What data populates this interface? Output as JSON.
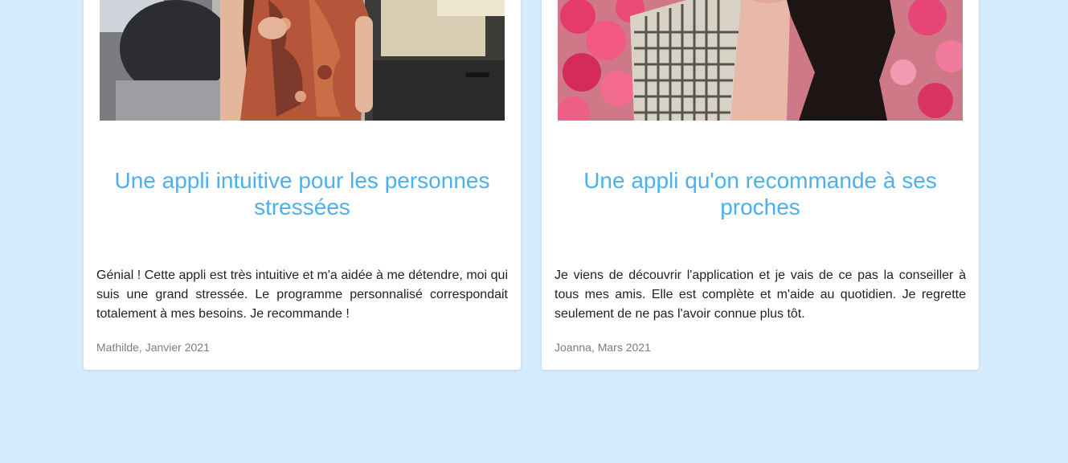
{
  "colors": {
    "page_background": "#d6ecfd",
    "card_background": "#ffffff",
    "title": "#4db0ec",
    "body_text": "#222222",
    "author_text": "#7d7d7d"
  },
  "testimonials": [
    {
      "photo": "woman-in-paisley-dress-photo",
      "title": "Une appli intuitive pour les personnes stressées",
      "text": "Génial ! Cette appli est très intuitive et m'a aidée à me détendre, moi qui suis une grand stressée. Le programme personnalisé correspondait totalement à mes besoins. Je recommande !",
      "author": "Mathilde, Janvier 2021"
    },
    {
      "photo": "woman-with-pink-flowers-photo",
      "title": "Une appli qu'on recommande à ses proches",
      "text": "Je viens de découvrir l'application et je vais de ce pas la conseiller à tous mes amis. Elle est complète et m'aide au quotidien. Je regrette seulement de ne pas l'avoir connue plus tôt.",
      "author": "Joanna, Mars 2021"
    }
  ]
}
